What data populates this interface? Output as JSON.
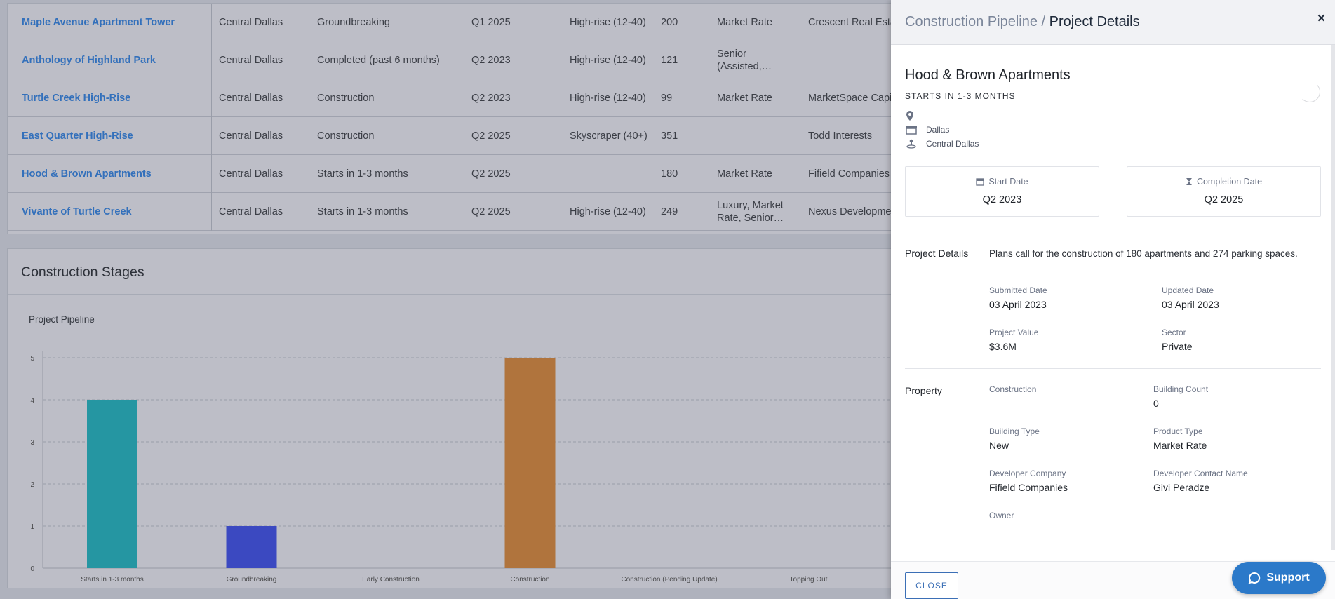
{
  "table": {
    "rows": [
      {
        "name": "Maple Avenue Apartment Tower",
        "region": "Central Dallas",
        "status": "Groundbreaking",
        "date": "Q1 2025",
        "type": "High-rise (12-40)",
        "units": "200",
        "market": "Market Rate",
        "developer": "Crescent Real Estate LLC"
      },
      {
        "name": "Anthology of Highland Park",
        "region": "Central Dallas",
        "status": "Completed (past 6 months)",
        "date": "Q2 2023",
        "type": "High-rise (12-40)",
        "units": "121",
        "market": "Senior (Assisted,…",
        "developer": ""
      },
      {
        "name": "Turtle Creek High-Rise",
        "region": "Central Dallas",
        "status": "Construction",
        "date": "Q2 2023",
        "type": "High-rise (12-40)",
        "units": "99",
        "market": "Market Rate",
        "developer": "MarketSpace Capital"
      },
      {
        "name": "East Quarter High-Rise",
        "region": "Central Dallas",
        "status": "Construction",
        "date": "Q2 2025",
        "type": "Skyscraper (40+)",
        "units": "351",
        "market": "",
        "developer": "Todd Interests"
      },
      {
        "name": "Hood & Brown Apartments",
        "region": "Central Dallas",
        "status": "Starts in 1-3 months",
        "date": "Q2 2025",
        "type": "",
        "units": "180",
        "market": "Market Rate",
        "developer": "Fifield Companies"
      },
      {
        "name": "Vivante of Turtle Creek",
        "region": "Central Dallas",
        "status": "Starts in 1-3 months",
        "date": "Q2 2025",
        "type": "High-rise (12-40)",
        "units": "249",
        "market": "Luxury, Market Rate, Senior…",
        "developer": "Nexus Development"
      }
    ]
  },
  "stages": {
    "title": "Construction Stages",
    "chart_title": "Project Pipeline"
  },
  "chart_data": {
    "type": "bar",
    "title": "Project Pipeline",
    "categories": [
      "Starts in 1-3 months",
      "Groundbreaking",
      "Early Construction",
      "Construction",
      "Construction (Pending Update)",
      "Topping Out"
    ],
    "values": [
      4,
      1,
      0,
      5,
      0,
      0
    ],
    "colors": [
      "#1a9aa6",
      "#3343c9",
      "#999999",
      "#b87333",
      "#999999",
      "#999999"
    ],
    "ylim": [
      0,
      5
    ],
    "yticks": [
      0,
      1,
      2,
      3,
      4,
      5
    ],
    "grid": true,
    "xlabel": "",
    "ylabel": ""
  },
  "panel": {
    "crumb_parent": "Construction Pipeline / ",
    "crumb_current": "Project Details",
    "close_x": "×",
    "project_name": "Hood & Brown Apartments",
    "status": "STARTS IN 1-3 MONTHS",
    "city": "Dallas",
    "region": "Central Dallas",
    "start_label": "Start Date",
    "start_value": "Q2 2023",
    "completion_label": "Completion Date",
    "completion_value": "Q2 2025",
    "details_label": "Project Details",
    "description": "Plans call for the construction of 180 apartments and 274 parking spaces.",
    "submitted_label": "Submitted Date",
    "submitted_value": "03 April 2023",
    "updated_label": "Updated Date",
    "updated_value": "03 April 2023",
    "value_label": "Project Value",
    "value_value": "$3.6M",
    "sector_label": "Sector",
    "sector_value": "Private",
    "property_label": "Property",
    "construction_label": "Construction",
    "construction_value": "",
    "building_count_label": "Building Count",
    "building_count_value": "0",
    "building_type_label": "Building Type",
    "building_type_value": "New",
    "product_type_label": "Product Type",
    "product_type_value": "Market Rate",
    "dev_company_label": "Developer Company",
    "dev_company_value": "Fifield Companies",
    "dev_contact_label": "Developer Contact Name",
    "dev_contact_value": "Givi Peradze",
    "owner_label": "Owner",
    "close_button": "CLOSE"
  },
  "support": {
    "label": "Support"
  },
  "icons": [
    "location-pin-icon",
    "store-icon",
    "region-icon",
    "calendar-icon",
    "hourglass-icon",
    "chat-icon"
  ]
}
